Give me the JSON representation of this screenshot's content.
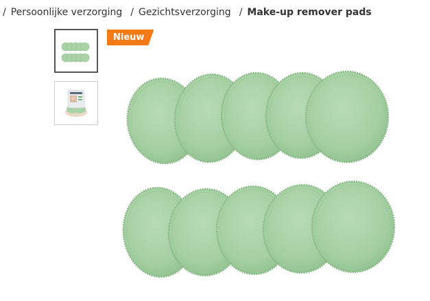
{
  "breadcrumb": {
    "items": [
      {
        "label": "Persoonlijke verzorging"
      },
      {
        "label": "Gezichtsverzorging"
      }
    ],
    "current": "Make-up remover pads",
    "separator": "/"
  },
  "badge": {
    "label": "Nieuw",
    "color": "#f47a18"
  },
  "gallery": {
    "thumbnails": [
      {
        "icon": "pads-thumbnail",
        "active": true
      },
      {
        "icon": "package-thumbnail",
        "active": false
      }
    ],
    "pad_color": "#a9d3a7"
  }
}
